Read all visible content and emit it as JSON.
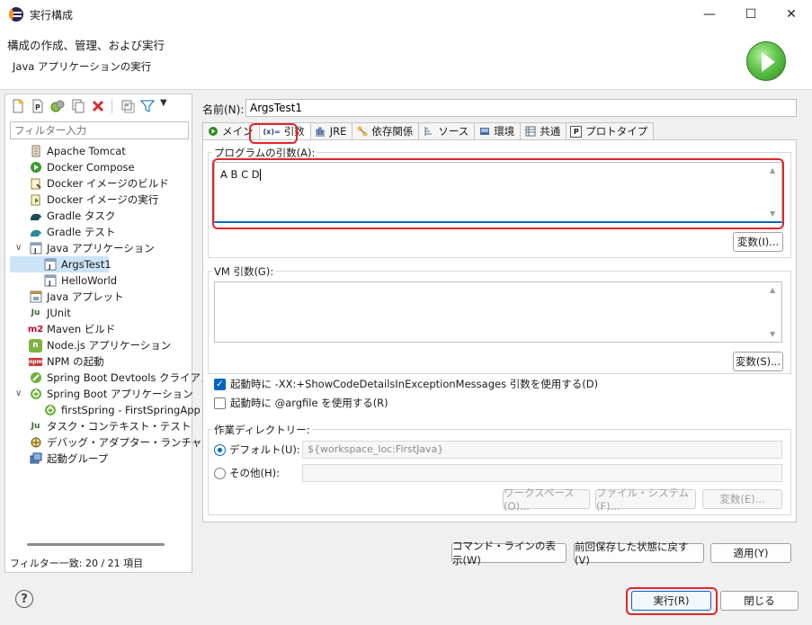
{
  "window": {
    "title": "実行構成",
    "minimize": "—",
    "maximize": "☐",
    "close": "✕"
  },
  "header": {
    "title": "構成の作成、管理、および実行",
    "subtitle": "Java アプリケーションの実行"
  },
  "filter": {
    "placeholder": "フィルター入力",
    "status": "フィルター一致: 20 / 21 項目"
  },
  "tree": [
    {
      "label": "Apache Tomcat",
      "icon": "tomcat-icon"
    },
    {
      "label": "Docker Compose",
      "icon": "docker-compose-icon"
    },
    {
      "label": "Docker イメージのビルド",
      "icon": "docker-build-icon"
    },
    {
      "label": "Docker イメージの実行",
      "icon": "docker-run-icon"
    },
    {
      "label": "Gradle タスク",
      "icon": "gradle-icon"
    },
    {
      "label": "Gradle テスト",
      "icon": "gradle-test-icon"
    },
    {
      "label": "Java アプリケーション",
      "icon": "java-app-icon"
    },
    {
      "label": "ArgsTest1",
      "icon": "java-config-icon"
    },
    {
      "label": "HelloWorld",
      "icon": "java-config-icon"
    },
    {
      "label": "Java アプレット",
      "icon": "java-applet-icon"
    },
    {
      "label": "JUnit",
      "icon": "junit-icon",
      "glyph": "Ju"
    },
    {
      "label": "Maven ビルド",
      "icon": "maven-icon",
      "glyph": "m2"
    },
    {
      "label": "Node.js アプリケーション",
      "icon": "nodejs-icon",
      "glyph": "n"
    },
    {
      "label": "NPM の起動",
      "icon": "npm-icon",
      "glyph": "npm"
    },
    {
      "label": "Spring Boot Devtools クライアン",
      "icon": "spring-devtools-icon"
    },
    {
      "label": "Spring Boot アプリケーション",
      "icon": "spring-boot-icon"
    },
    {
      "label": "firstSpring - FirstSpringApp",
      "icon": "spring-config-icon"
    },
    {
      "label": "タスク・コンテキスト・テスト",
      "icon": "task-context-icon",
      "glyph": "Ju"
    },
    {
      "label": "デバッグ・アダプター・ランチャー",
      "icon": "debug-adapter-icon"
    },
    {
      "label": "起動グループ",
      "icon": "launch-group-icon"
    }
  ],
  "config": {
    "name_label": "名前(N):",
    "name_value": "ArgsTest1"
  },
  "tabs": [
    {
      "label": "メイン",
      "icon": "main-tab-icon"
    },
    {
      "label": "引数",
      "icon": "arguments-tab-icon",
      "glyph": "(x)="
    },
    {
      "label": "JRE",
      "icon": "jre-tab-icon"
    },
    {
      "label": "依存関係",
      "icon": "dependencies-tab-icon"
    },
    {
      "label": "ソース",
      "icon": "source-tab-icon"
    },
    {
      "label": "環境",
      "icon": "environment-tab-icon"
    },
    {
      "label": "共通",
      "icon": "common-tab-icon"
    },
    {
      "label": "プロトタイプ",
      "icon": "prototype-tab-icon",
      "glyph": "P"
    }
  ],
  "args": {
    "program_label": "プログラムの引数(A):",
    "program_value": "A B C D",
    "program_var_button": "変数(I)...",
    "vm_label": "VM 引数(G):",
    "vm_value": "",
    "vm_var_button": "変数(S)...",
    "cb_show_details": "起動時に -XX:+ShowCodeDetailsInExceptionMessages 引数を使用する(D)",
    "cb_show_details_checked": true,
    "cb_argfile": "起動時に @argfile を使用する(R)",
    "cb_argfile_checked": false
  },
  "workdir": {
    "label": "作業ディレクトリー:",
    "default_label": "デフォルト(U):",
    "default_value": "${workspace_loc:FirstJava}",
    "other_label": "その他(H):",
    "other_value": "",
    "workspace_button": "ワークスペース(O)...",
    "filesystem_button": "ファイル・システム(F)...",
    "variables_button": "変数(E)..."
  },
  "bottom": {
    "show_cmd": "コマンド・ラインの表示(W)",
    "revert": "前回保存した状態に戻す(V)",
    "apply": "適用(Y)",
    "run": "実行(R)",
    "close": "閉じる",
    "help": "?"
  },
  "colors": {
    "accent": "#0067c0",
    "highlight": "#e0262b",
    "selected": "#cce4f7"
  }
}
